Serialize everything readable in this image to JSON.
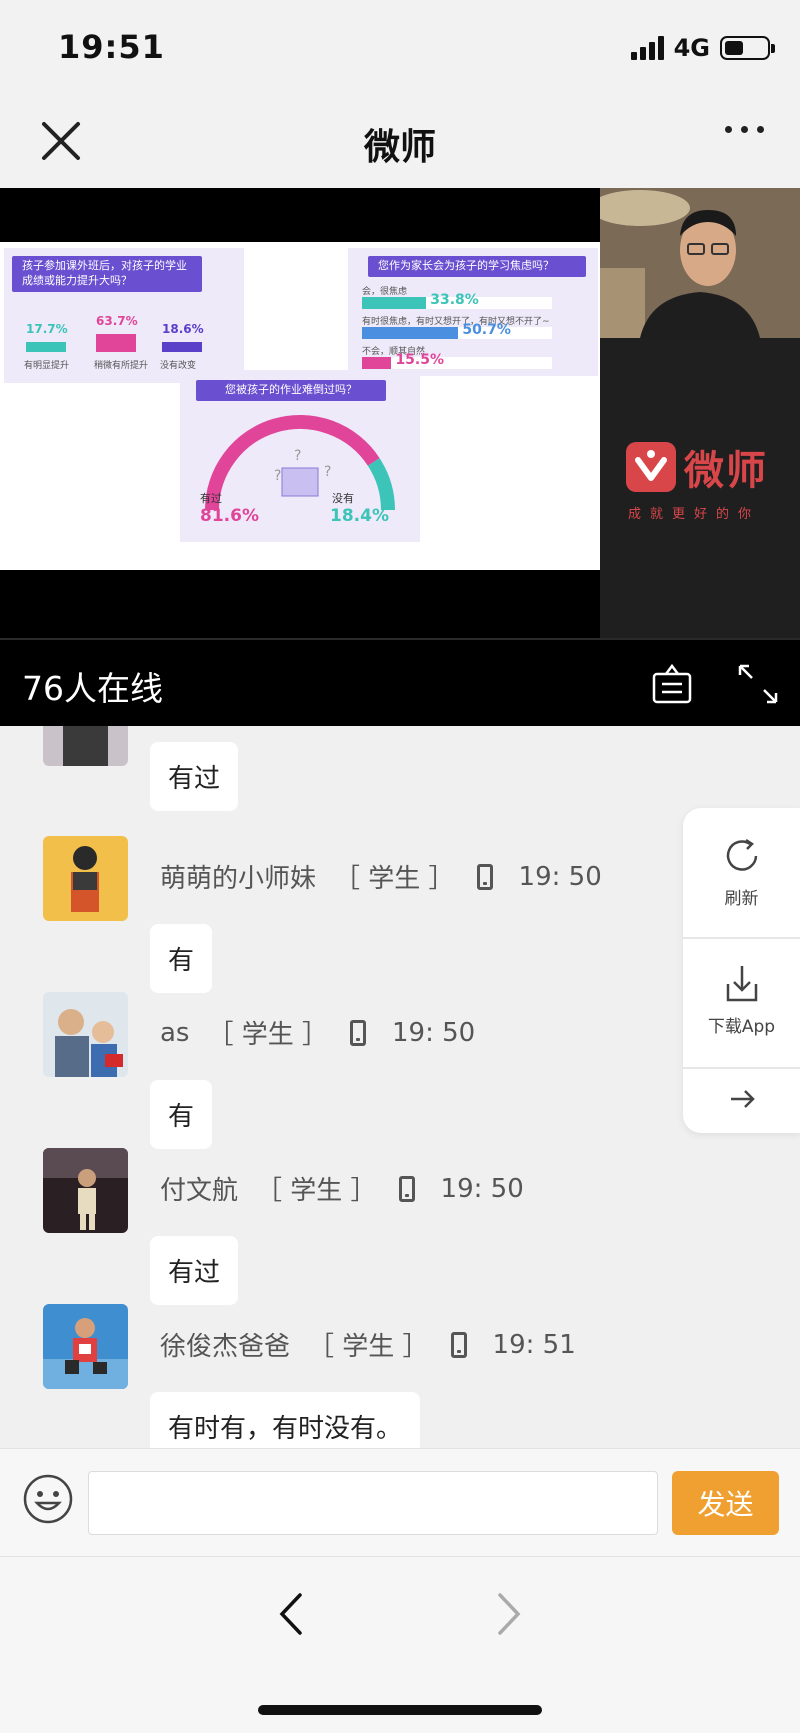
{
  "status_bar": {
    "time": "19:51",
    "network": "4G",
    "battery_level": 0.45
  },
  "nav": {
    "title": "微师"
  },
  "slide": {
    "card1": {
      "title": "孩子参加课外班后，对孩子的学业成绩或能力提升大吗？",
      "items": [
        {
          "label": "有明显提升",
          "pct": "17.7%",
          "color": "#3cc4b8"
        },
        {
          "label": "稍微有所提升",
          "pct": "63.7%",
          "color": "#e0459a"
        },
        {
          "label": "没有改变",
          "pct": "18.6%",
          "color": "#5a3fc8"
        }
      ]
    },
    "card2": {
      "title": "您作为家长会为孩子的学习焦虑吗？",
      "items": [
        {
          "label": "会，很焦虑",
          "pct": "33.8%",
          "color": "#3cc4b8"
        },
        {
          "label": "有时很焦虑，有时又想开了，有时又想不开了~",
          "pct": "50.7%",
          "color": "#4a8fe0"
        },
        {
          "label": "不会，顺其自然",
          "pct": "15.5%",
          "color": "#e0459a"
        }
      ]
    },
    "card3": {
      "title": "您被孩子的作业难倒过吗？",
      "left_label": "有过",
      "left_pct": "81.6%",
      "right_label": "没有",
      "right_pct": "18.4%"
    }
  },
  "brand": {
    "name": "微师",
    "tagline": "成就更好的你",
    "color": "#d9464a"
  },
  "online": {
    "text": "76人在线"
  },
  "messages": [
    {
      "name": "",
      "role": "",
      "time": "",
      "text": "有过"
    },
    {
      "name": "萌萌的小师妹",
      "role": "［ 学生 ］",
      "time": "19: 50",
      "text": "有"
    },
    {
      "name": "as",
      "role": "［ 学生 ］",
      "time": "19: 50",
      "text": "有"
    },
    {
      "name": "付文航",
      "role": "［ 学生 ］",
      "time": "19: 50",
      "text": "有过"
    },
    {
      "name": "徐俊杰爸爸",
      "role": "［ 学生 ］",
      "time": "19: 51",
      "text": "有时有，有时没有。"
    }
  ],
  "side_tools": {
    "refresh": "刷新",
    "download": "下载App"
  },
  "input": {
    "value": "",
    "placeholder": "",
    "send_label": "发送"
  },
  "colors": {
    "send_button": "#f0a030",
    "accent_purple": "#6a4fd0"
  }
}
